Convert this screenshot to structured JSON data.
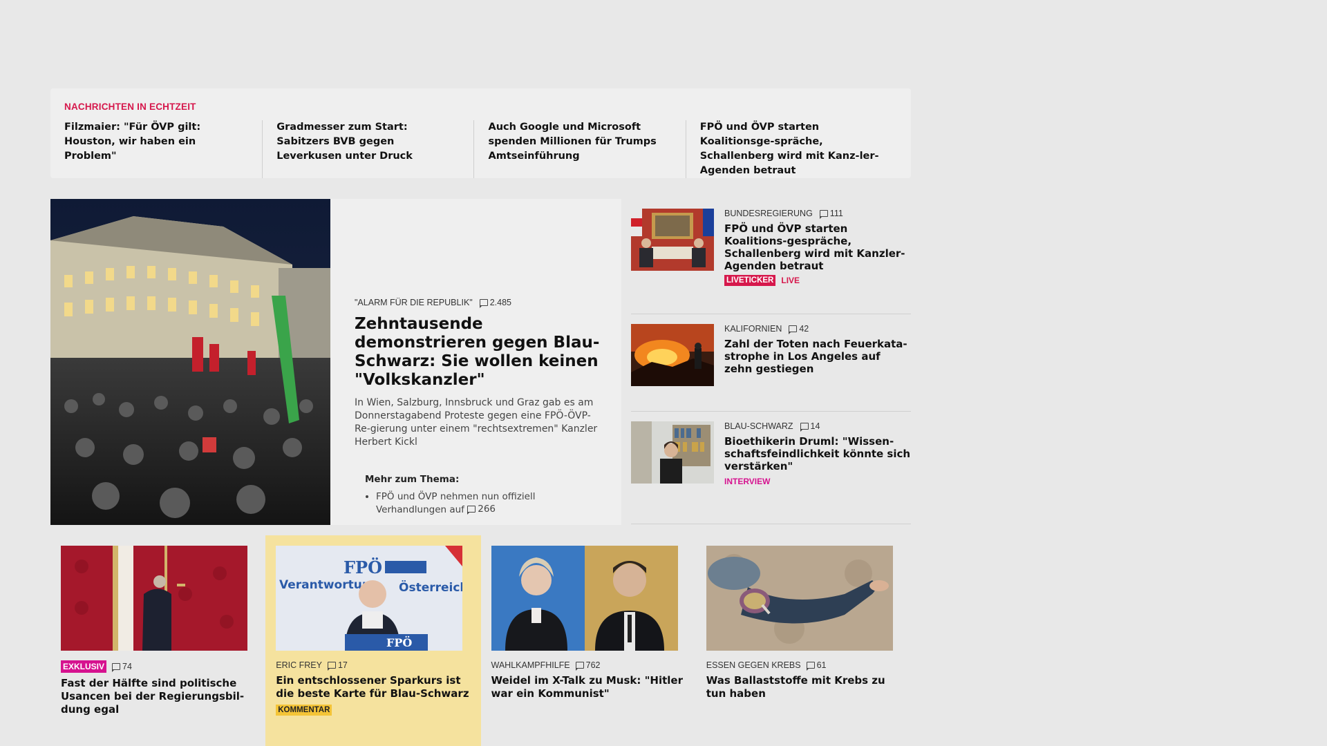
{
  "ticker": {
    "label": "NACHRICHTEN IN ECHTZEIT",
    "items": [
      "Filzmaier: \"Für ÖVP gilt: Houston, wir haben ein Problem\"",
      "Gradmesser zum Start: Sabitzers BVB gegen Leverkusen unter Druck",
      "Auch Google und Microsoft spenden Millionen für Trumps Amtseinführung",
      "FPÖ und ÖVP starten Koalitionsge-spräche, Schallenberg wird mit Kanz-ler-Agenden betraut"
    ]
  },
  "lead": {
    "kicker": "\"ALARM FÜR DIE REPUBLIK\"",
    "comments": "2.485",
    "title": "Zehntausende demonstrieren gegen Blau-Schwarz: Sie wollen keinen \"Volkskanzler\"",
    "teaser": "In Wien, Salzburg, Innsbruck und Graz gab es am Donnerstagabend Proteste gegen eine FPÖ-ÖVP-Re-gierung unter einem \"rechtsextremen\" Kanzler Herbert Kickl",
    "more_title": "Mehr zum Thema:",
    "more_items": [
      {
        "text": "FPÖ und ÖVP nehmen nun offiziell Verhandlungen auf",
        "comments": "266"
      }
    ]
  },
  "side": [
    {
      "kicker": "BUNDESREGIERUNG",
      "comments": "111",
      "title": "FPÖ und ÖVP starten Koalitions-gespräche, Schallenberg wird mit Kanzler-Agenden betraut",
      "badge": "LIVETICKER",
      "badge_extra": "LIVE"
    },
    {
      "kicker": "KALIFORNIEN",
      "comments": "42",
      "title": "Zahl der Toten nach Feuerkata-strophe in Los Angeles auf zehn gestiegen"
    },
    {
      "kicker": "BLAU-SCHWARZ",
      "comments": "14",
      "title": "Bioethikerin Druml: \"Wissen-schaftsfeindlichkeit könnte sich verstärken\"",
      "tag": "INTERVIEW"
    }
  ],
  "cards": [
    {
      "badge": "EXKLUSIV",
      "comments": "74",
      "title": "Fast der Hälfte sind politische Usancen bei der Regierungsbil-dung egal"
    },
    {
      "kicker": "ERIC FREY",
      "comments": "17",
      "title": "Ein entschlossener Sparkurs ist die beste Karte für Blau-Schwarz",
      "tag": "KOMMENTAR",
      "img_text_1": "FPÖ",
      "img_text_2": "Verantwortung",
      "img_text_3": "Österreich"
    },
    {
      "kicker": "WAHLKAMPFHILFE",
      "comments": "762",
      "title": "Weidel im X-Talk zu Musk: \"Hitler war ein Kommunist\""
    },
    {
      "kicker": "ESSEN GEGEN KREBS",
      "comments": "61",
      "title": "Was Ballaststoffe mit Krebs zu tun haben"
    }
  ],
  "colors": {
    "page_bg": "#e8e8e8",
    "panel_bg": "#efefef",
    "accent_red": "#d6184c",
    "accent_magenta": "#d6128f",
    "comment_highlight": "#f5e29e",
    "kommentar_badge": "#f4c437"
  }
}
